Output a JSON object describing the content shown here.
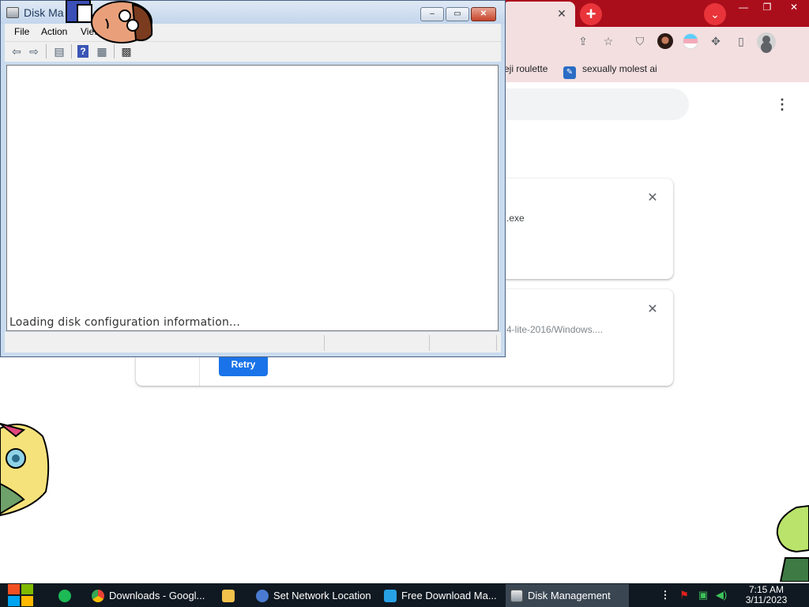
{
  "browser": {
    "tab_close_label": "✕",
    "new_tab_label": "+",
    "tab_search_label": "⌄",
    "window_controls": [
      "—",
      "❐",
      "✕"
    ],
    "bookmarks": [
      {
        "label": "eji roulette"
      },
      {
        "label": "sexually molest ai"
      }
    ],
    "menu_label": "⋮",
    "downloads": [
      {
        "filename": ".exe",
        "close_label": "✕"
      },
      {
        "url": "4-lite-2016/Windows....",
        "close_label": "✕",
        "action_label": "Retry"
      }
    ],
    "colors": {
      "tab_strip": "#ab0e1b",
      "toolbar": "#f3dfe0",
      "accent": "#1a73e8"
    }
  },
  "disk_management": {
    "title": "Disk Ma",
    "controls": [
      "‒",
      "▭",
      "✕"
    ],
    "menu": [
      "File",
      "Action",
      "View"
    ],
    "status_text": "Loading disk configuration information..."
  },
  "taskbar": {
    "apps": [
      {
        "label": "Downloads - Googl...",
        "icon": "chrome-icon"
      },
      {
        "label": "Set Network Location",
        "icon": "network-icon"
      },
      {
        "label": "Free Download Ma...",
        "icon": "fdm-icon"
      },
      {
        "label": "Disk Management",
        "icon": "disk-management-icon",
        "active": true
      }
    ],
    "clock": {
      "time": "7:15 AM",
      "date": "3/11/2023"
    }
  }
}
